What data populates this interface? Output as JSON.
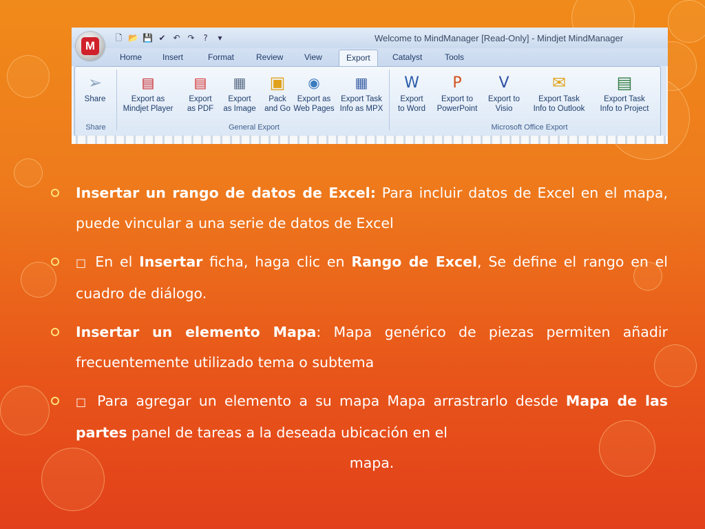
{
  "screenshot": {
    "window_title": "Welcome to MindManager [Read-Only] - Mindjet MindManager",
    "app_logo": "M",
    "tabs": [
      "Home",
      "Insert",
      "Format",
      "Review",
      "View",
      "Export",
      "Catalyst",
      "Tools"
    ],
    "active_tab": "Export",
    "groups": [
      {
        "label": "Share",
        "buttons": [
          {
            "label": "Share",
            "icon": "paper-plane-icon"
          }
        ]
      },
      {
        "label": "General Export",
        "buttons": [
          {
            "label": "Export as\nMindjet Player",
            "icon": "pdf-document-icon"
          },
          {
            "label": "Export\nas PDF",
            "icon": "pdf-icon"
          },
          {
            "label": "Export\nas Image",
            "icon": "image-document-icon"
          },
          {
            "label": "Pack\nand Go",
            "icon": "package-icon"
          },
          {
            "label": "Export as\nWeb Pages",
            "icon": "web-page-icon"
          },
          {
            "label": "Export Task\nInfo as MPX",
            "icon": "task-export-icon"
          }
        ]
      },
      {
        "label": "Microsoft Office Export",
        "buttons": [
          {
            "label": "Export\nto Word",
            "icon": "word-icon"
          },
          {
            "label": "Export to\nPowerPoint",
            "icon": "powerpoint-icon"
          },
          {
            "label": "Export to\nVisio",
            "icon": "visio-icon"
          },
          {
            "label": "Export Task\nInfo to Outlook",
            "icon": "outlook-icon"
          },
          {
            "label": "Export Task\nInfo to Project",
            "icon": "project-icon"
          }
        ]
      }
    ]
  },
  "bullets": [
    {
      "bold_lead": "Insertar un rango de datos de Excel:",
      "text": " Para incluir datos de Excel en el mapa, puede vincular a una serie de datos de Excel"
    },
    {
      "prefix": " En el ",
      "bold1": "Insertar",
      "mid": " ficha, haga clic en ",
      "bold2": "Rango de Excel",
      "text": ", Se define el rango en el cuadro de diálogo."
    },
    {
      "bold_lead": "Insertar un elemento Mapa",
      "text": ": Mapa genérico de piezas permiten añadir frecuentemente utilizado tema o subtema"
    },
    {
      "prefix": " Para agregar un elemento a su mapa Mapa arrastrarlo desde ",
      "bold1": "Mapa de las partes",
      "text": " panel de tareas a la deseada ubicación en el",
      "last_line": "mapa."
    }
  ],
  "colors": {
    "background_top": "#f08a1a",
    "background_bottom": "#e2401a",
    "bullet_marker": "#ffe27a",
    "text": "#ffffff"
  }
}
